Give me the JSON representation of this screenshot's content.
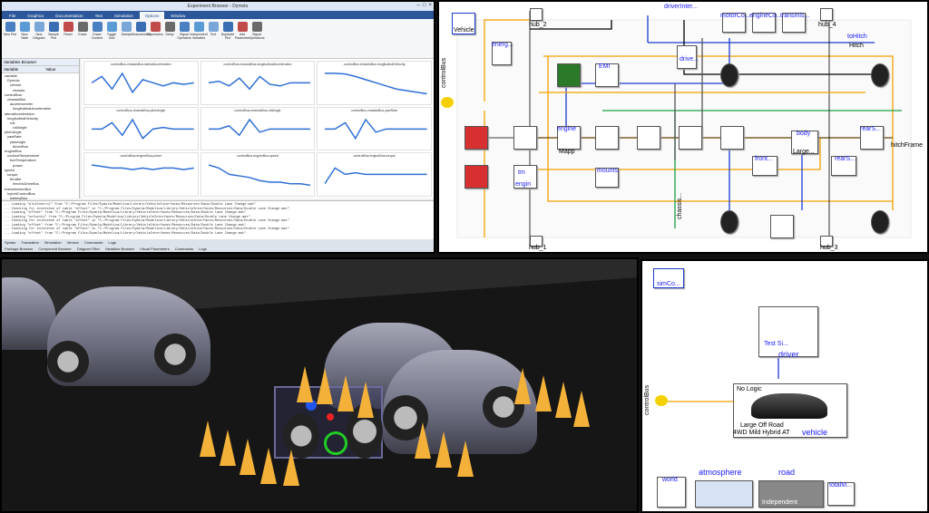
{
  "ide": {
    "title": "Experiment Browser - Dymola",
    "tabs": [
      "File",
      "Graphics",
      "Documentation",
      "Text",
      "Simulation",
      "Options",
      "Window"
    ],
    "active_tab": "Options",
    "ribbon_buttons": [
      "New Plot",
      "New Table",
      "New Diagram",
      "Sample Plot",
      "Reset",
      "Erase",
      "Erase Content",
      "Toggle Grid",
      "Sweep",
      "Measurement",
      "Expression",
      "Setup",
      "Signal Operators",
      "Independent Variables",
      "Text",
      "Duplicate Plot",
      "Add Parameter",
      "Signal Operations"
    ],
    "browser_header": "Variables Browser",
    "browser_columns": [
      "Variable",
      "Value",
      "Unit"
    ],
    "browser_rows": [
      "variable",
      "Dymola",
      "vehicle",
      "chassis",
      "controlBus",
      "chassisBus",
      "accelerometer",
      "longitudinalAcceleration",
      "lateralAcceleration",
      "longitudinalVelocity",
      "roll",
      "rollAngle",
      "pitchAngle",
      "yawRate",
      "yawAngle",
      "driverBus",
      "engineBus",
      "coolantTemperature",
      "fuelTemperature",
      "power",
      "speed",
      "torque",
      "throttle",
      "electricDriveBus",
      "transmissionBus",
      "hybridControlBus",
      "batteryBus",
      "electricDriveBus1",
      "electricDriveBus2",
      "frontExpansionBus",
      "hubBus"
    ],
    "plots": [
      {
        "title": "controlBus.chassisBus.lateralAcceleration",
        "color": "#2f6fd6"
      },
      {
        "title": "controlBus.chassisBus.longitudinalAcceleration",
        "color": "#2f6fd6"
      },
      {
        "title": "controlBus.chassisBus.longitudinalVelocity",
        "color": "#2f6fd6"
      },
      {
        "title": "controlBus.chassisBus.pitchAngle",
        "color": "#2f6fd6"
      },
      {
        "title": "controlBus.chassisBus.rollAngle",
        "color": "#2f6fd6"
      },
      {
        "title": "controlBus.chassisBus.yawRate",
        "color": "#2f6fd6"
      },
      {
        "title": "controlBus.engineBus.power",
        "color": "#2f6fd6"
      },
      {
        "title": "controlBus.engineBus.speed",
        "color": "#2f6fd6"
      },
      {
        "title": "controlBus.engineBus.torque",
        "color": "#2f6fd6"
      }
    ],
    "commands": [
      "... Loading \"plotControl\" from \"C:/Program Files/Dymola/Modelica/Library/VehicleInterfaces/Resources/Data/Double Lane Change.mat\"",
      "... Checking for existence of table \"offset\" in \"C:/Program Files/Dymola/Modelica/Library/VehicleInterfaces/Resources/Data/Double Lane Change.mat\"",
      "... Loading \"offset\" from \"C:/Program Files/Dymola/Modelica/Library/VehicleInterfaces/Resources/Data/Double Lane Change.mat\"",
      "... Loading \"velocity\" from \"C:/Program Files/Dymola/Modelica/Library/VehicleInterfaces/Resources/Data/Double Lane Change.mat\"",
      "... Checking for existence of table \"offset\" in \"C:/Program Files/Dymola/Modelica/Library/VehicleInterfaces/Resources/Data/Double Lane Change.mat\"",
      "... Loading \"offset\" from \"C:/Program Files/Dymola/Modelica/Library/VehicleInterfaces/Resources/Data/Double Lane Change.mat\"",
      "... Checking for existence of table \"offset\" in \"C:/Program Files/Dymola/Modelica/Library/VehicleInterfaces/Resources/Data/Double Lane Change.mat\"",
      "... Loading \"offset\" from \"C:/Program Files/Dymola/Modelica/Library/VehicleInterfaces/Resources/Data/Double Lane Change.mat\""
    ],
    "status_tabs": [
      "Syntax",
      "Translation",
      "Simulation",
      "Version"
    ],
    "status_tabs2": [
      "Commands",
      "Logs"
    ],
    "status_bottom": [
      "Package Browser",
      "Component Browser",
      "Diagram Filter",
      "Variables Browser",
      "Visual Parameters",
      "Commands",
      "Logs"
    ]
  },
  "diagram": {
    "labels": {
      "vehicle": "Vehicle",
      "controlBus": "controlBus",
      "hub2": "hub_2",
      "driverInter": "driverInter...",
      "motorCo": "motorCo...",
      "engineCo": "engineCo...",
      "transmis": "transmis...",
      "hub4": "hub_4",
      "toHitch": "toHitch",
      "hitch": "Hitch",
      "energ": "energ...",
      "emi": "EMI",
      "drivel": "drive...",
      "engine": "engine",
      "mapp": "Mapp",
      "body": "body",
      "large": "Large...",
      "front": "front...",
      "rear": "rearS...",
      "mounts": "mounts",
      "tm": "tm",
      "engin": "engin",
      "hitchFrame": "hitchFrame",
      "hub1": "hub_1",
      "chassis": "chassis...",
      "hub3": "hub_3"
    }
  },
  "sim": {
    "labels": {
      "simco": "simCo...",
      "controlBus": "controlBus",
      "test": "Test Si...",
      "driver": "driver",
      "nologic": "No Logic",
      "large": "Large Off Road",
      "hybrid": "4WD Mild Hybrid AT",
      "vehicle": "vehicle",
      "world": "world",
      "atmosphere": "atmosphere",
      "road": "road",
      "independent": "Independent",
      "total": "totalM..."
    }
  },
  "colors": {
    "ribbon_blue": "#2b579a",
    "plot_line": "#2f6fd6",
    "wire_orange": "#f5a000",
    "wire_blue": "#1a3ccf",
    "wire_green": "#1aa043",
    "cone": "#f3b13a"
  }
}
